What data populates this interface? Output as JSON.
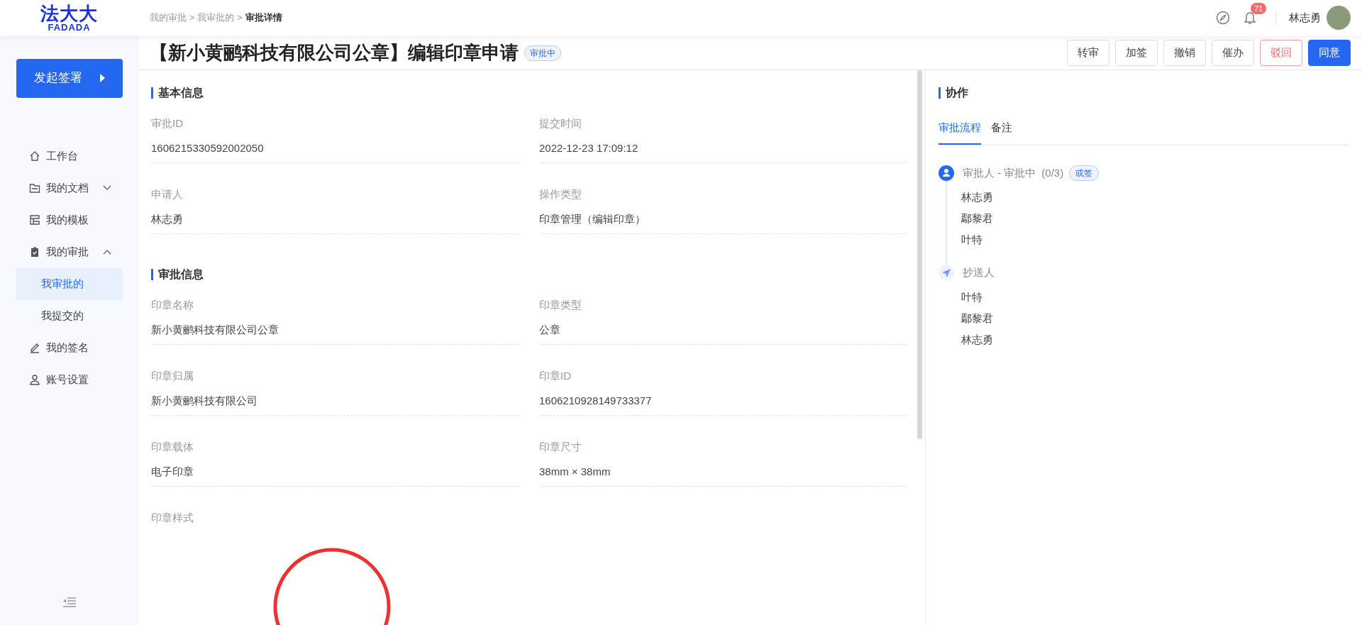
{
  "header": {
    "logo_cn": "法大大",
    "logo_en": "FADADA",
    "breadcrumb": [
      {
        "label": "我的审批",
        "current": false
      },
      {
        "label": "我审批的",
        "current": false
      },
      {
        "label": "审批详情",
        "current": true
      }
    ],
    "separator": ">",
    "notification_count": "71",
    "user_name": "林志勇"
  },
  "sidebar": {
    "start_button": "发起签署",
    "items": [
      {
        "label": "工作台"
      },
      {
        "label": "我的文档",
        "expanded": false
      },
      {
        "label": "我的模板"
      },
      {
        "label": "我的审批",
        "expanded": true,
        "children": [
          {
            "label": "我审批的",
            "selected": true
          },
          {
            "label": "我提交的",
            "selected": false
          }
        ]
      },
      {
        "label": "我的签名"
      },
      {
        "label": "账号设置"
      }
    ]
  },
  "title": "【新小黄鹂科技有限公司公章】编辑印章申请",
  "status_tag": "审批中",
  "actions": [
    {
      "label": "转审",
      "kind": "default"
    },
    {
      "label": "加签",
      "kind": "default"
    },
    {
      "label": "撤销",
      "kind": "default"
    },
    {
      "label": "催办",
      "kind": "default"
    },
    {
      "label": "驳回",
      "kind": "danger"
    },
    {
      "label": "同意",
      "kind": "primary"
    }
  ],
  "sections": [
    {
      "title": "基本信息",
      "fields": [
        {
          "label": "审批ID",
          "value": "1606215330592002050",
          "kind": "text"
        },
        {
          "label": "提交时间",
          "value": "2022-12-23 17:09:12",
          "kind": "text"
        },
        {
          "label": "申请人",
          "value": "林志勇",
          "kind": "text"
        },
        {
          "label": "操作类型",
          "value": "印章管理（编辑印章）",
          "kind": "text"
        }
      ]
    },
    {
      "title": "审批信息",
      "fields": [
        {
          "label": "印章名称",
          "value": "新小黄鹂科技有限公司公章",
          "kind": "text"
        },
        {
          "label": "印章类型",
          "value": "公章",
          "kind": "text"
        },
        {
          "label": "印章归属",
          "value": "新小黄鹂科技有限公司",
          "kind": "text"
        },
        {
          "label": "印章ID",
          "value": "1606210928149733377",
          "kind": "text"
        },
        {
          "label": "印章载体",
          "value": "电子印章",
          "kind": "text"
        },
        {
          "label": "印章尺寸",
          "value": "38mm × 38mm",
          "kind": "text"
        },
        {
          "label": "印章样式",
          "kind": "seal"
        }
      ]
    }
  ],
  "collab": {
    "title": "协作",
    "tabs": [
      {
        "label": "审批流程",
        "selected": true
      },
      {
        "label": "备注",
        "selected": false
      }
    ],
    "flow": [
      {
        "kind": "approver",
        "title": "审批人 - 审批中",
        "count": "(0/3)",
        "tag": "或签",
        "people": [
          "林志勇",
          "鄢黎君",
          "叶特"
        ]
      },
      {
        "kind": "cc",
        "title": "抄送人",
        "people": [
          "叶特",
          "鄢黎君",
          "林志勇"
        ]
      }
    ]
  }
}
